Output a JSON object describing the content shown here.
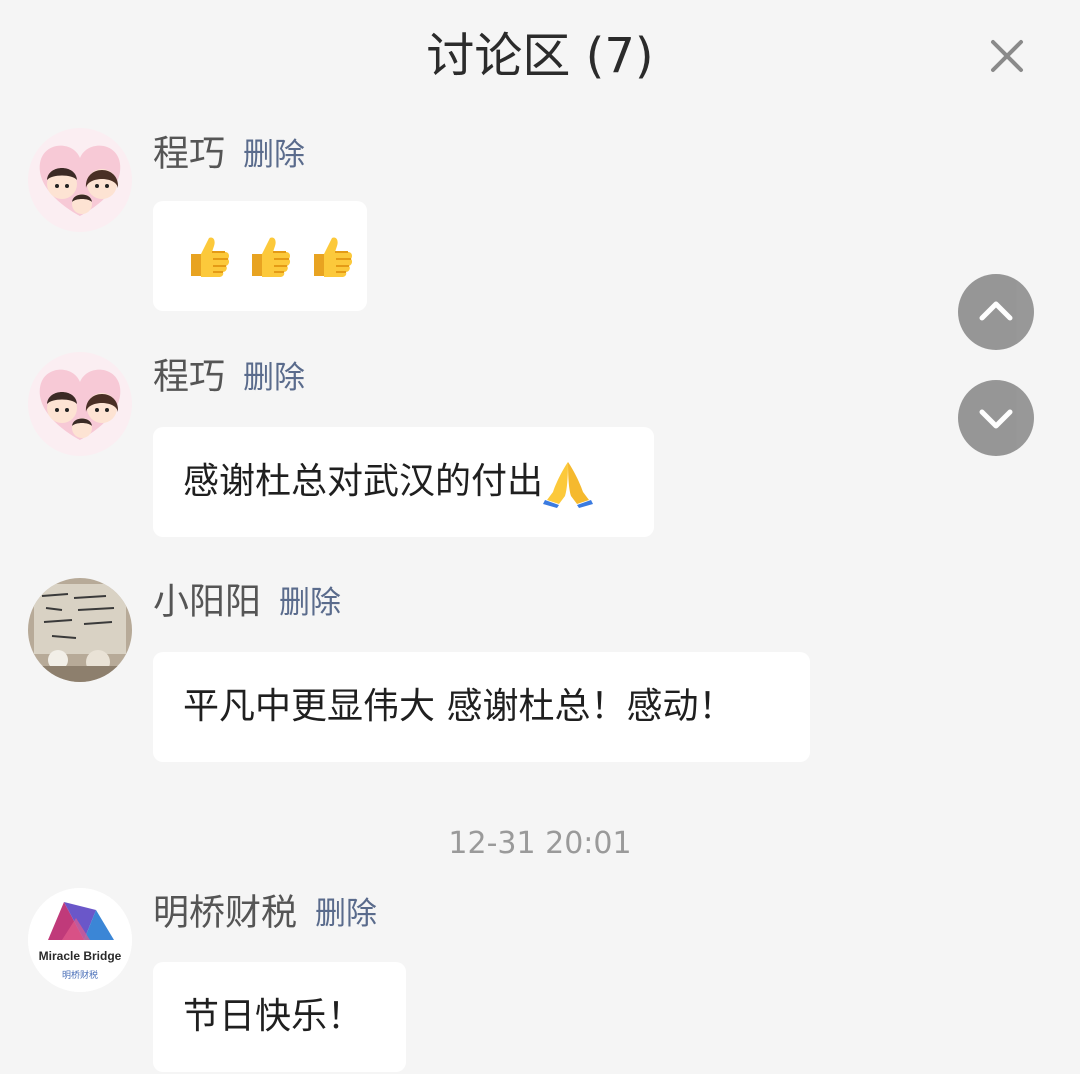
{
  "header": {
    "title": "讨论区 (7)",
    "close_icon": "close-icon"
  },
  "messages": [
    {
      "user": "程巧",
      "delete_label": "删除",
      "avatar": "couple-cartoon-avatar",
      "content_text": "",
      "emoji": [
        "thumbs-up-icon",
        "thumbs-up-icon",
        "thumbs-up-icon"
      ]
    },
    {
      "user": "程巧",
      "delete_label": "删除",
      "avatar": "couple-cartoon-avatar",
      "content_text": "感谢杜总对武汉的付出",
      "emoji": [
        "folded-hands-icon"
      ]
    },
    {
      "user": "小阳阳",
      "delete_label": "删除",
      "avatar": "doodle-photo-avatar",
      "content_text": "平凡中更显伟大 感谢杜总！感动！",
      "emoji": []
    },
    {
      "user": "明桥财税",
      "delete_label": "删除",
      "avatar": "miracle-bridge-logo-avatar",
      "avatar_text": "Miracle Bridge",
      "avatar_subtext": "明桥财税",
      "content_text": "节日快乐！",
      "emoji": []
    }
  ],
  "timestamp": "12-31 20:01",
  "scroll_controls": {
    "up_icon": "chevron-up-icon",
    "down_icon": "chevron-down-icon"
  },
  "colors": {
    "background": "#f5f5f5",
    "bubble": "#ffffff",
    "delete_link": "#5a6b8c",
    "fab": "#8f8f8f"
  }
}
